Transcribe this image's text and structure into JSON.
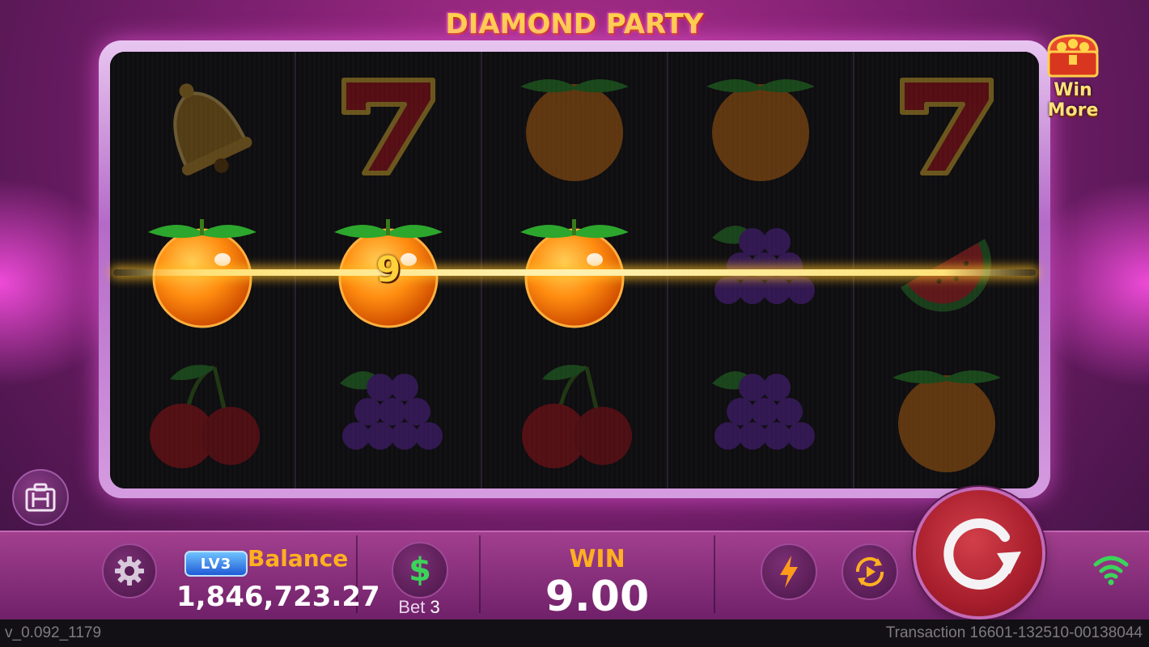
{
  "header": {
    "title": "DIAMOND PARTY"
  },
  "win_more": {
    "label": "Win More",
    "icon": "treasure-chest-icon"
  },
  "reels": [
    {
      "symbols": [
        "bell",
        "orange",
        "cherry"
      ]
    },
    {
      "symbols": [
        "seven",
        "orange",
        "grapes"
      ]
    },
    {
      "symbols": [
        "orange",
        "orange",
        "cherry"
      ]
    },
    {
      "symbols": [
        "orange",
        "grapes",
        "grapes"
      ]
    },
    {
      "symbols": [
        "seven",
        "watermelon",
        "orange"
      ]
    }
  ],
  "payline": {
    "row": 2,
    "winning_symbol": "orange",
    "count": 3,
    "value": "9"
  },
  "controls": {
    "settings_icon": "gear-icon",
    "level_badge": "LV3",
    "balance_label": "Balance",
    "balance_value": "1,846,723.27",
    "bet_icon": "dollar-icon",
    "bet_label": "Bet",
    "bet_value": "3",
    "win_label": "WIN",
    "win_value": "9.00",
    "turbo_icon": "lightning-icon",
    "autoplay_icon": "autoplay-icon",
    "spin_icon": "spin-arrow-icon",
    "signal_icon": "wifi-icon"
  },
  "footer": {
    "version": "v_0.092_1179",
    "transaction": "Transaction 16601-132510-00138044"
  },
  "colors": {
    "accent_gold": "#ffb020",
    "spin_red": "#a81e2c",
    "wifi_green": "#3cd35a"
  }
}
